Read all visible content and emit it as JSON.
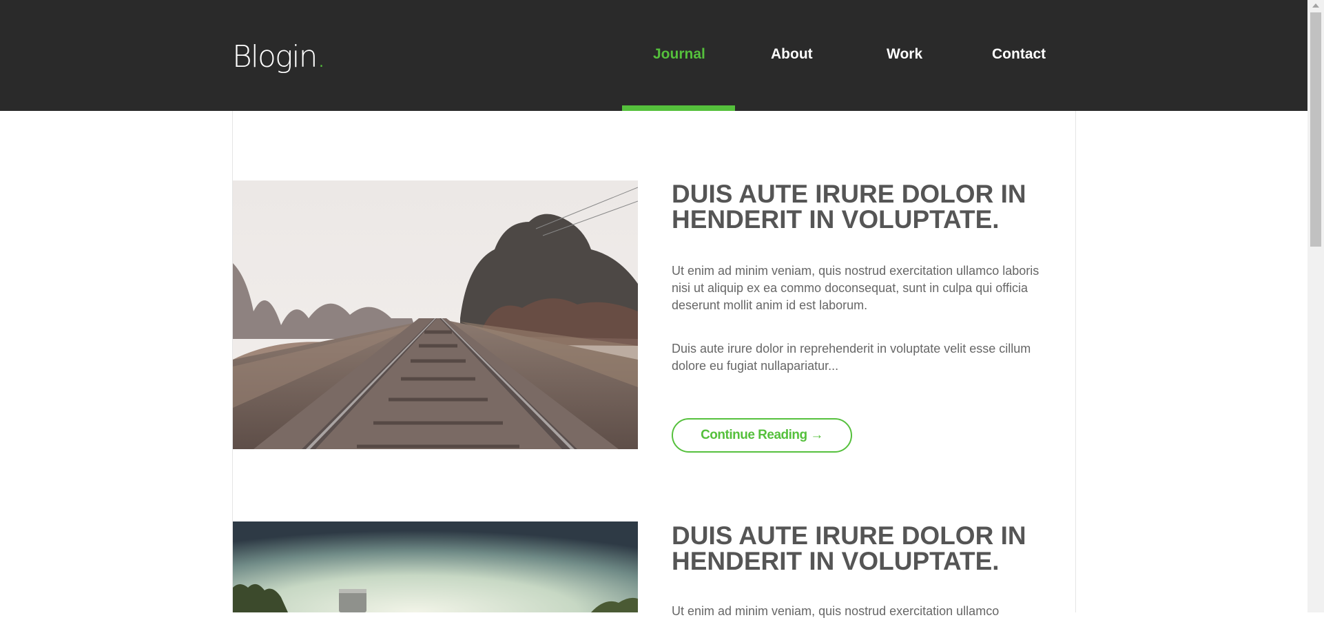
{
  "brand": {
    "name": "Blogin",
    "dot": ".",
    "accent_color": "#55c03c",
    "header_bg": "#2a2a2a"
  },
  "nav": {
    "items": [
      {
        "label": "Journal",
        "active": true
      },
      {
        "label": "About",
        "active": false
      },
      {
        "label": "Work",
        "active": false
      },
      {
        "label": "Contact",
        "active": false
      }
    ]
  },
  "posts": [
    {
      "image_subject": "railway tracks through a misty field",
      "title": "DUIS AUTE IRURE DOLOR IN HENDERIT IN VOLUPTATE.",
      "paragraphs": [
        "Ut enim ad minim veniam, quis nostrud exercitation ullamco laboris nisi ut aliquip ex ea commo doconsequat, sunt in culpa qui officia deserunt mollit anim id est laborum.",
        "Duis aute irure dolor in reprehenderit in voluptate velit esse cillum dolore eu fugiat nullapariatur..."
      ],
      "button_label": "Continue Reading →"
    },
    {
      "image_subject": "water tower under a vignetted sky",
      "title": "DUIS AUTE IRURE DOLOR IN HENDERIT IN VOLUPTATE.",
      "paragraphs": [
        "Ut enim ad minim veniam, quis nostrud exercitation ullamco"
      ]
    }
  ]
}
